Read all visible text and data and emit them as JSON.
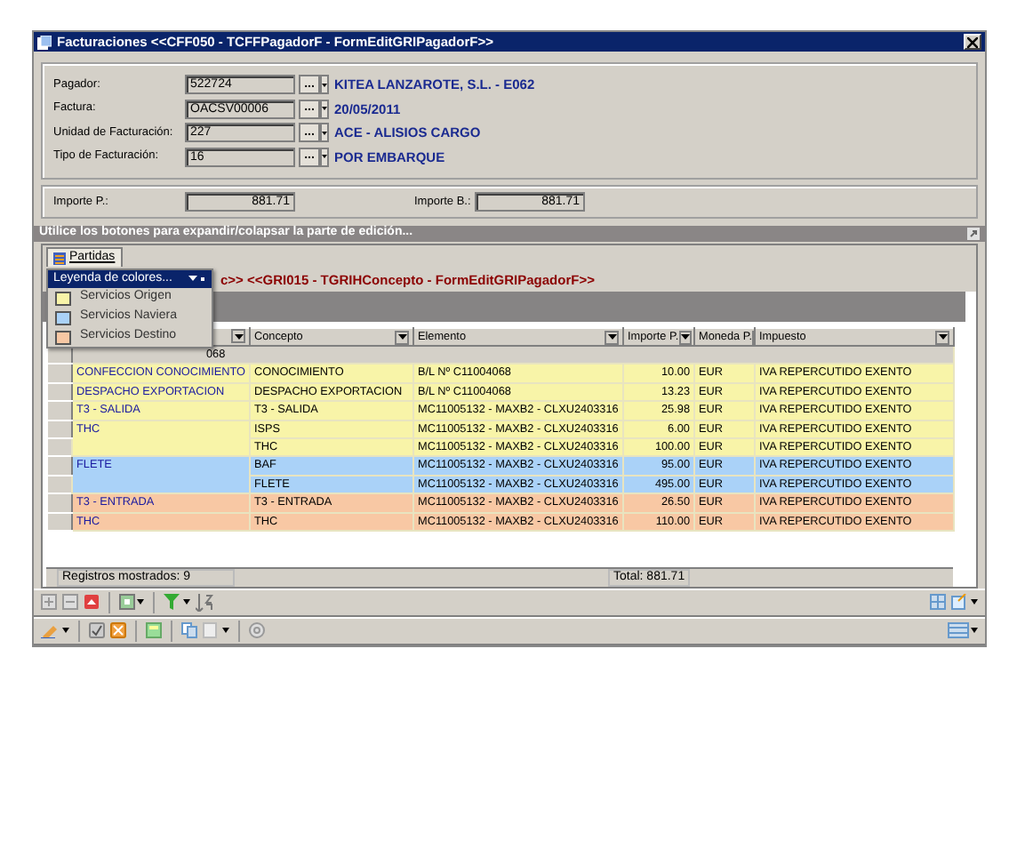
{
  "window": {
    "title": "Facturaciones <<CFF050 - TCFFPagadorF - FormEditGRIPagadorF>>"
  },
  "fields": [
    {
      "label": "Pagador:",
      "value": "522724",
      "description": "KITEA LANZAROTE, S.L. - E062"
    },
    {
      "label": "Factura:",
      "value": "OACSV00006",
      "description": "20/05/2011"
    },
    {
      "label": "Unidad de Facturación:",
      "value": "227",
      "description": "ACE - ALISIOS CARGO"
    },
    {
      "label": "Tipo de Facturación:",
      "value": "16",
      "description": "POR EMBARQUE"
    }
  ],
  "lookup_button": "...",
  "amounts": [
    {
      "label": "Importe P.:",
      "value": "881.71"
    },
    {
      "label": "Importe B.:",
      "value": "881.71"
    }
  ],
  "collapse_bar": "Utilice los botones para expandir/colapsar la parte de edición...",
  "tabs": [
    {
      "label": "Partidas",
      "selected": true
    }
  ],
  "grid_caption": "c>> <<GRI015 - TGRIHConcepto - FormEditGRIPagadorF>>",
  "legend": {
    "title": "Leyenda de colores...",
    "items": [
      {
        "label": "Servicios Origen",
        "color": "#f8f4a8"
      },
      {
        "label": "Servicios Naviera",
        "color": "#aad2f8"
      },
      {
        "label": "Servicios Destino",
        "color": "#f8c8a4"
      }
    ]
  },
  "table": {
    "columns": [
      "Concepto",
      "Elemento",
      "Importe P.",
      "Moneda P.",
      "Impuesto"
    ],
    "group_row": "068",
    "groups": [
      {
        "service": "CONFECCION CONOCIMIENTO",
        "color": "#f8f4a8",
        "lines": [
          [
            "CONOCIMIENTO",
            "B/L Nº C11004068",
            "10.00",
            "EUR",
            "IVA REPERCUTIDO EXENTO"
          ]
        ]
      },
      {
        "service": "DESPACHO EXPORTACION",
        "color": "#f8f4a8",
        "lines": [
          [
            "DESPACHO EXPORTACION",
            "B/L Nº C11004068",
            "13.23",
            "EUR",
            "IVA REPERCUTIDO EXENTO"
          ]
        ]
      },
      {
        "service": "T3 - SALIDA",
        "color": "#f8f4a8",
        "lines": [
          [
            "T3 - SALIDA",
            "MC11005132 - MAXB2 - CLXU2403316",
            "25.98",
            "EUR",
            "IVA REPERCUTIDO EXENTO"
          ]
        ]
      },
      {
        "service": "THC",
        "color": "#f8f4a8",
        "lines": [
          [
            "ISPS",
            "MC11005132 - MAXB2 - CLXU2403316",
            "6.00",
            "EUR",
            "IVA REPERCUTIDO EXENTO"
          ],
          [
            "THC",
            "MC11005132 - MAXB2 - CLXU2403316",
            "100.00",
            "EUR",
            "IVA REPERCUTIDO EXENTO"
          ]
        ]
      },
      {
        "service": "FLETE",
        "color": "#aad2f8",
        "lines": [
          [
            "BAF",
            "MC11005132 - MAXB2 - CLXU2403316",
            "95.00",
            "EUR",
            "IVA REPERCUTIDO EXENTO"
          ],
          [
            "FLETE",
            "MC11005132 - MAXB2 - CLXU2403316",
            "495.00",
            "EUR",
            "IVA REPERCUTIDO EXENTO"
          ]
        ]
      },
      {
        "service": "T3 - ENTRADA",
        "color": "#f8c8a4",
        "lines": [
          [
            "T3 - ENTRADA",
            "MC11005132 - MAXB2 - CLXU2403316",
            "26.50",
            "EUR",
            "IVA REPERCUTIDO EXENTO"
          ]
        ]
      },
      {
        "service": "THC",
        "color": "#f8c8a4",
        "lines": [
          [
            "THC",
            "MC11005132 - MAXB2 - CLXU2403316",
            "110.00",
            "EUR",
            "IVA REPERCUTIDO EXENTO"
          ]
        ]
      }
    ]
  },
  "footer": {
    "records": "Registros mostrados: 9",
    "total": "Total: 881.71"
  }
}
